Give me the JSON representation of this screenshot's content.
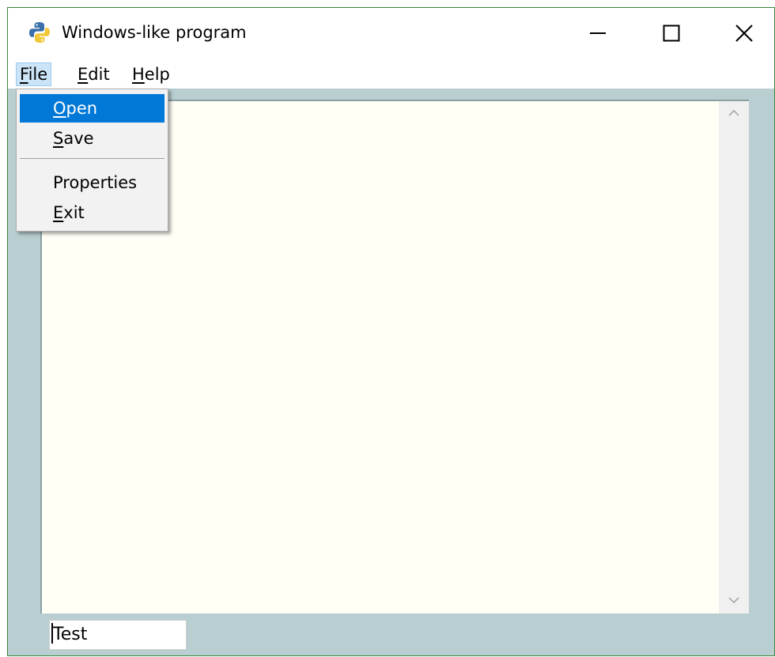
{
  "window": {
    "title": "Windows-like program",
    "icon": "python-logo-icon",
    "controls": [
      "minimize-icon",
      "maximize-icon",
      "close-icon"
    ]
  },
  "menubar": {
    "items": [
      {
        "label": "File",
        "accel": "F",
        "rest": "ile",
        "active": true
      },
      {
        "label": "Edit",
        "accel": "E",
        "rest": "dit",
        "active": false
      },
      {
        "label": "Help",
        "accel": "H",
        "rest": "elp",
        "active": false
      }
    ]
  },
  "file_menu": {
    "items": [
      {
        "label": "Open",
        "accel": "O",
        "rest": "pen",
        "selected": true
      },
      {
        "label": "Save",
        "accel": "S",
        "rest": "ave",
        "selected": false
      },
      {
        "label": "Properties",
        "accel": "",
        "rest": "Properties",
        "selected": false
      },
      {
        "label": "Exit",
        "accel": "E",
        "rest": "xit",
        "selected": false
      }
    ]
  },
  "status_field": {
    "value": "Test"
  },
  "colors": {
    "client_bg": "#b8ced0",
    "text_area_bg": "#fffff6",
    "menu_highlight": "#0078d7",
    "menubar_active": "#cce4f7"
  }
}
